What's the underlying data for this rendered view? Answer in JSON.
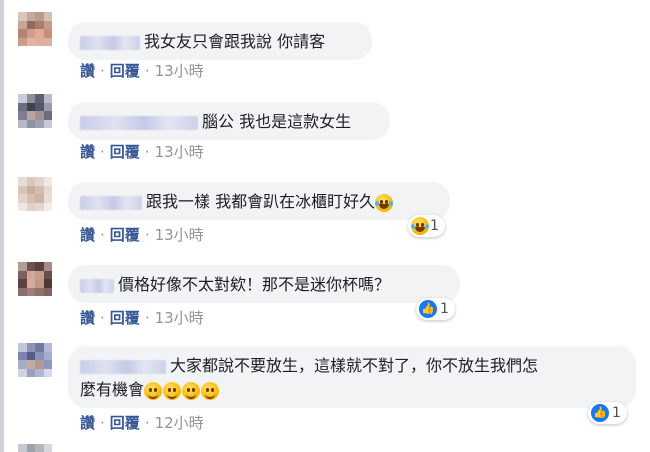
{
  "actions": {
    "like": "讚",
    "reply": "回覆"
  },
  "comments": [
    {
      "name_hidden": true,
      "text": "我女友只會跟我說 你請客",
      "time": "13小時",
      "reaction": null,
      "emoji_suffix": ""
    },
    {
      "name_hidden": true,
      "text": "腦公 我也是這款女生",
      "time": "13小時",
      "reaction": null,
      "emoji_suffix": ""
    },
    {
      "name_hidden": true,
      "text": "跟我一樣 我都會趴在冰櫃盯好久",
      "time": "13小時",
      "reaction": {
        "type": "haha-icon",
        "count": "1"
      },
      "emoji_suffix": "haha-emoji"
    },
    {
      "name_hidden": true,
      "text": "價格好像不太對欸！那不是迷你杯嗎？",
      "time": "13小時",
      "reaction": {
        "type": "like-icon",
        "count": "1"
      },
      "emoji_suffix": ""
    },
    {
      "name_hidden": true,
      "text_line1": "大家都說不要放生，這樣就不對了，你不放生我們怎",
      "text_line2": "麼有機會",
      "time": "12小時",
      "reaction": {
        "type": "like-icon",
        "count": "1"
      },
      "emoji_suffix": "smile-emoji-x4"
    }
  ],
  "colors": {
    "link": "#385898",
    "bubble": "#f2f3f5",
    "like": "#1877f2"
  }
}
